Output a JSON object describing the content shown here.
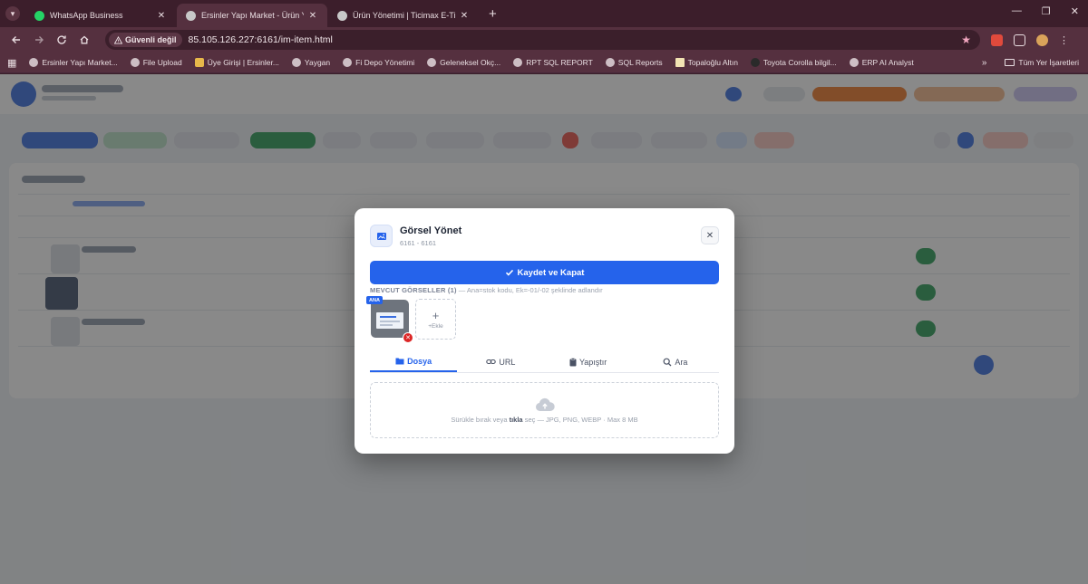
{
  "browser": {
    "tabs": [
      {
        "title": "WhatsApp Business",
        "active": false,
        "color": "#25d366"
      },
      {
        "title": "Ersinler Yapı Market - Ürün Yöne",
        "active": true,
        "color": "#c8c8c8"
      },
      {
        "title": "Ürün Yönetimi | Ticimax E-Ticar",
        "active": false,
        "color": "#c8c8c8"
      }
    ],
    "security_label": "Güvenli değil",
    "url": "85.105.126.227:6161/im-item.html",
    "bookmarks": [
      "Ersinler Yapı Market...",
      "File Upload",
      "Üye Girişi | Ersinler...",
      "Yaygan",
      "Fi Depo Yönetimi",
      "Geleneksel Okç...",
      "RPT SQL REPORT",
      "SQL Reports",
      "Topaloğlu Altın",
      "Toyota Corolla bilgil...",
      "ERP AI Analyst"
    ],
    "all_bookmarks_label": "Tüm Yer İşaretleri",
    "icons": {
      "new_tab": "+",
      "more": "»",
      "minimize": "—",
      "restore": "❐",
      "close": "✕"
    }
  },
  "modal": {
    "title": "Görsel Yönet",
    "subtitle": "6161 - 6161",
    "close_glyph": "✕",
    "save_label": "Kaydet ve Kapat",
    "section_label": "MEVCUT GÖRSELLER (1)",
    "section_hint": " — Ana=stok kodu, Ek=-01/-02 şeklinde adlandır",
    "main_badge": "ANA",
    "delete_glyph": "✕",
    "add_plus": "+",
    "add_label": "+Ekle",
    "tabs": [
      {
        "label": "Dosya",
        "icon": "folder-icon",
        "active": true
      },
      {
        "label": "URL",
        "icon": "link-icon",
        "active": false
      },
      {
        "label": "Yapıştır",
        "icon": "clipboard-icon",
        "active": false
      },
      {
        "label": "Ara",
        "icon": "search-icon",
        "active": false
      }
    ],
    "dropzone": {
      "text_before": "Sürükle bırak veya ",
      "text_bold": "tıkla",
      "text_after": " seç — JPG, PNG, WEBP · Max 8 MB"
    }
  },
  "colors": {
    "accent": "#2563eb",
    "danger": "#dc2626"
  }
}
